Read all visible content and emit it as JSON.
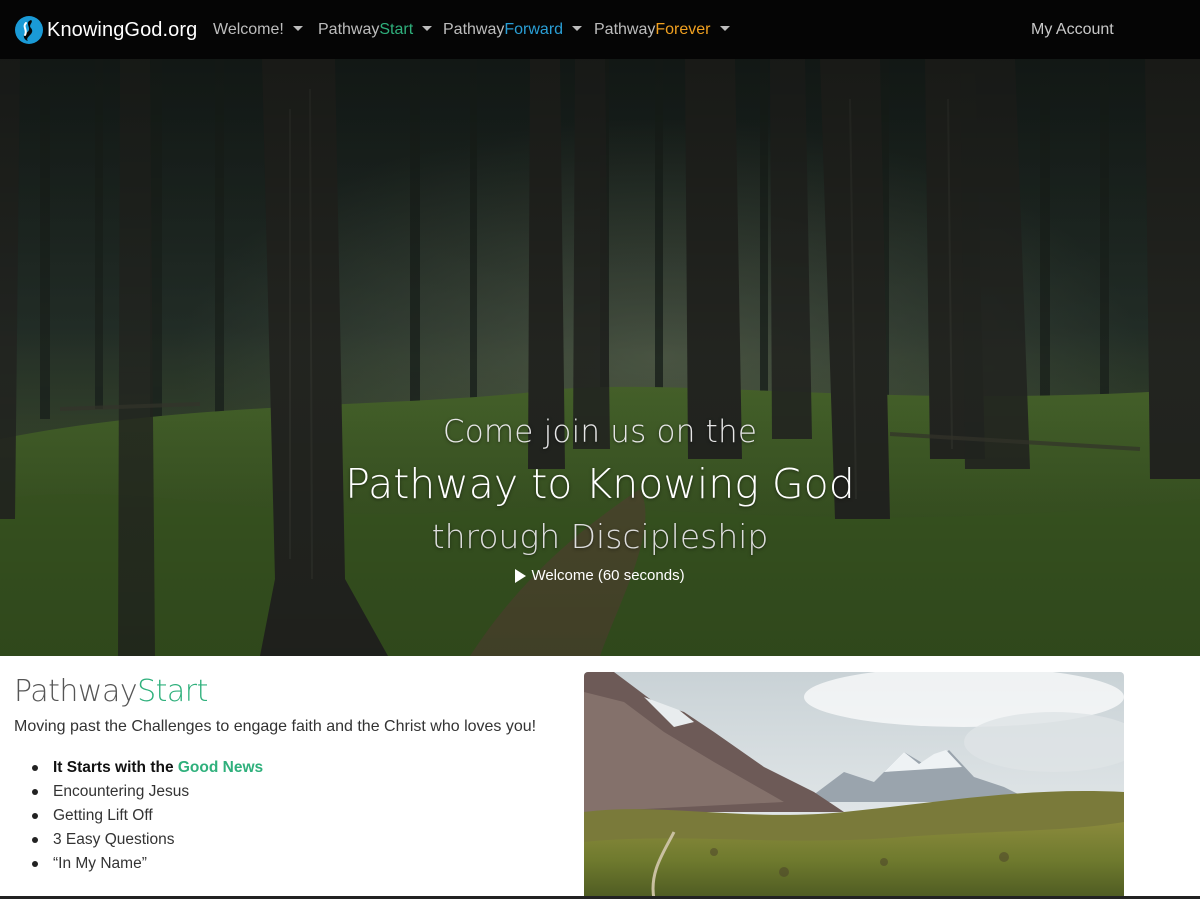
{
  "navbar": {
    "brand": "KnowingGod.org",
    "items": [
      {
        "prefix": "Welcome!",
        "accent": ""
      },
      {
        "prefix": "Pathway",
        "accent": "Start"
      },
      {
        "prefix": "Pathway",
        "accent": "Forward"
      },
      {
        "prefix": "Pathway",
        "accent": "Forever"
      }
    ],
    "account": "My Account"
  },
  "hero": {
    "line1": "Come join us on the",
    "line2": "Pathway to Knowing God",
    "line3": "through Discipleship",
    "video_label": "Welcome (60 seconds)"
  },
  "section": {
    "title_prefix": "Pathway",
    "title_accent": "Start",
    "description": "Moving past the Challenges to engage faith and the Christ who loves you!",
    "list": [
      {
        "text": "It Starts with the ",
        "accent": "Good News"
      },
      {
        "text": "Encountering Jesus"
      },
      {
        "text": "Getting Lift Off"
      },
      {
        "text": "3 Easy Questions"
      },
      {
        "text": "“In My Name”"
      }
    ]
  },
  "colors": {
    "green": "#2fb07c",
    "blue": "#2a9fd6",
    "orange": "#f0a020",
    "navbar_bg": "#050505"
  },
  "icons": [
    "logo-icon",
    "caret-down-icon",
    "play-icon"
  ]
}
